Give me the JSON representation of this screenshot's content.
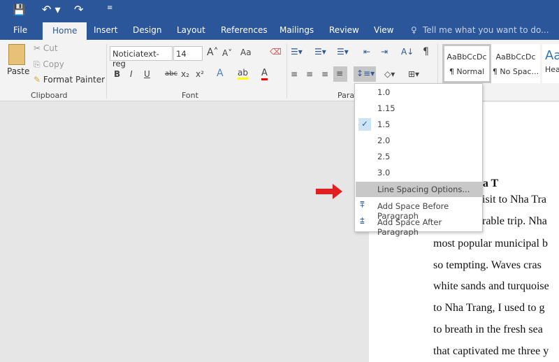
{
  "qat": {
    "save": "save-icon",
    "undo": "undo-icon",
    "redo": "redo-icon",
    "customize": "customize-icon"
  },
  "tabs": [
    "File",
    "Home",
    "Insert",
    "Design",
    "Layout",
    "References",
    "Mailings",
    "Review",
    "View"
  ],
  "tell_me": "Tell me what you want to do...",
  "clipboard": {
    "paste": "Paste",
    "cut": "Cut",
    "copy": "Copy",
    "format_painter": "Format Painter",
    "label": "Clipboard"
  },
  "font": {
    "name": "Noticiatext-reg",
    "size": "14",
    "label": "Font",
    "bold": "B",
    "italic": "I",
    "underline": "U",
    "strike": "abc",
    "sub": "x₂",
    "sup": "x²",
    "case": "Aa"
  },
  "paragraph": {
    "label": "Parag"
  },
  "styles": [
    {
      "preview": "AaBbCcDc",
      "name": "¶ Normal"
    },
    {
      "preview": "AaBbCcDc",
      "name": "¶ No Spac..."
    },
    {
      "preview": "Aa",
      "name": "Hea"
    }
  ],
  "line_spacing_menu": {
    "options": [
      "1.0",
      "1.15",
      "1.5",
      "2.0",
      "2.5",
      "3.0"
    ],
    "checked": "1.5",
    "line_spacing_options": "Line Spacing Options...",
    "add_before": "Add Space Before Paragraph",
    "add_after": "Add Space After Paragraph"
  },
  "document": {
    "lines": [
      "tour in Nha T",
      "visit to Nha Tra",
      "orable trip. Nha",
      "most popular municipal b",
      "so tempting. Waves cras",
      "white sands and turquoise",
      "to Nha Trang, I used to g",
      "to breath in the fresh sea",
      "that captivated me three y"
    ]
  },
  "colors": {
    "accent": "#2b579a",
    "arrow": "#e02020"
  }
}
